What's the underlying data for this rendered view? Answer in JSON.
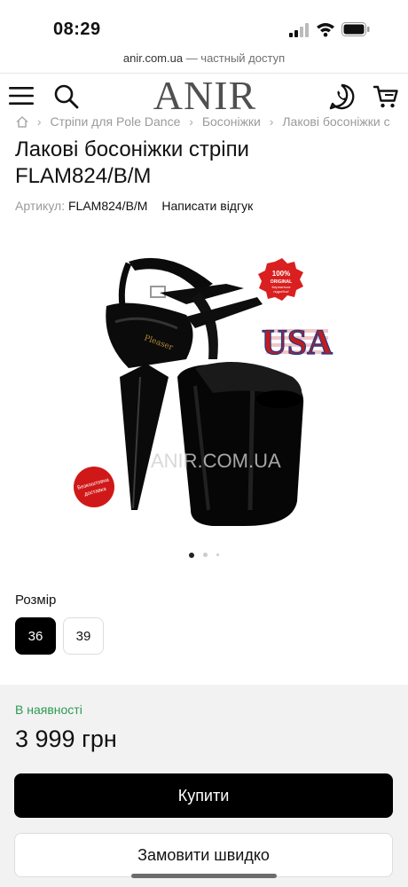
{
  "status": {
    "time": "08:29"
  },
  "browser": {
    "host": "anir.com.ua",
    "suffix": " — частный доступ"
  },
  "header": {
    "logo": "ANIR",
    "icons": [
      "menu-icon",
      "search-icon",
      "phone-icon",
      "cart-icon"
    ]
  },
  "breadcrumb": [
    "Стріпи для Pole Dance",
    "Босоніжки",
    "Лакові босоніжки с"
  ],
  "product": {
    "title": "Лакові босоніжки стріпи FLAM824/B/M",
    "sku_label": "Артикул:",
    "sku": "FLAM824/B/M",
    "review_link": "Написати відгук",
    "image": {
      "watermark": "ANIR.COM.UA",
      "badge_original": [
        "100%",
        "ORIGINAL",
        "Бережіться",
        "підробок!"
      ],
      "badge_usa": "USA",
      "badge_delivery": [
        "Безкоштовна",
        "доставка"
      ]
    },
    "gallery": {
      "count": 3,
      "active": 1
    }
  },
  "size": {
    "label": "Розмір",
    "options": [
      "36",
      "39"
    ],
    "selected": "36"
  },
  "purchase": {
    "stock": "В наявності",
    "price": "3 999 грн",
    "buy_label": "Купити",
    "quick_label": "Замовити швидко"
  },
  "colors": {
    "accent": "#000000",
    "stock": "#2b9a53",
    "panel": "#f2f2f2"
  }
}
